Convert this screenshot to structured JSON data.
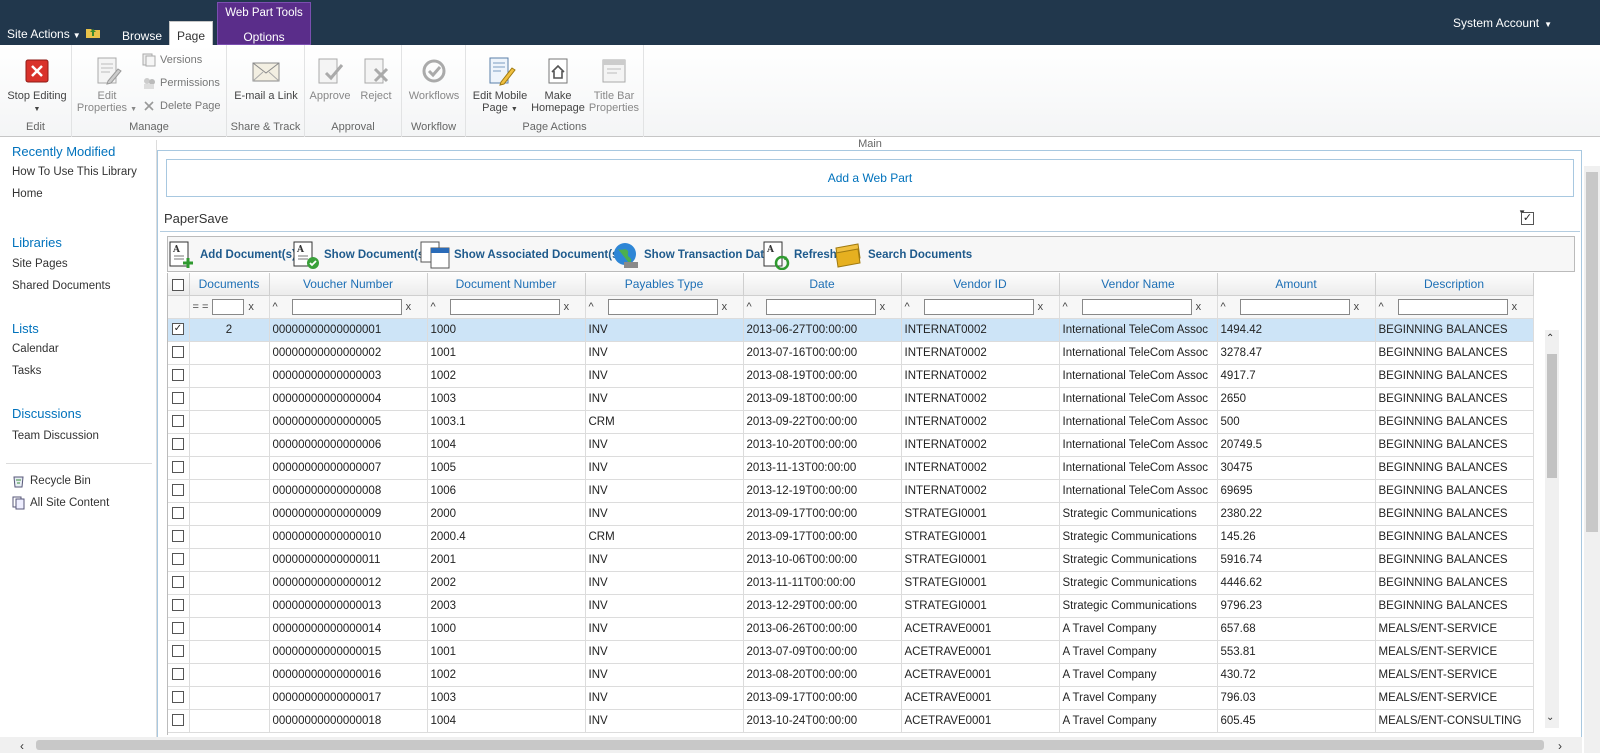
{
  "topbar": {
    "site_actions": "Site Actions",
    "tabs": [
      "Browse",
      "Page"
    ],
    "context_group": "Web Part Tools",
    "context_tab": "Options",
    "account": "System Account"
  },
  "ribbon": {
    "main_label": "Main",
    "groups": [
      {
        "label": "Edit",
        "buttons": [
          "Stop Editing"
        ]
      },
      {
        "label": "Manage",
        "buttons": [
          "Edit Properties",
          "Versions",
          "Permissions",
          "Delete Page"
        ]
      },
      {
        "label": "Share & Track",
        "buttons": [
          "E-mail a Link"
        ]
      },
      {
        "label": "Approval",
        "buttons": [
          "Approve",
          "Reject"
        ]
      },
      {
        "label": "Workflow",
        "buttons": [
          "Workflows"
        ]
      },
      {
        "label": "Page Actions",
        "buttons": [
          "Edit Mobile Page",
          "Make Homepage",
          "Title Bar Properties"
        ]
      }
    ]
  },
  "leftnav": {
    "recently_modified": "Recently Modified",
    "recent_items": [
      "How To Use This Library",
      "Home"
    ],
    "libraries": "Libraries",
    "library_items": [
      "Site Pages",
      "Shared Documents"
    ],
    "lists": "Lists",
    "list_items": [
      "Calendar",
      "Tasks"
    ],
    "discussions": "Discussions",
    "discussion_items": [
      "Team Discussion"
    ],
    "recycle_bin": "Recycle Bin",
    "all_site_content": "All Site Content"
  },
  "zone": {
    "add_webpart": "Add a Web Part"
  },
  "webpart": {
    "title": "PaperSave",
    "toolbar": [
      "Add Document(s)",
      "Show Document(s)",
      "Show Associated Document(s)",
      "Show Transaction Data",
      "Refresh",
      "Search Documents"
    ]
  },
  "grid": {
    "columns": [
      "Documents",
      "Voucher Number",
      "Document Number",
      "Payables Type",
      "Date",
      "Vendor ID",
      "Vendor Name",
      "Amount",
      "Description"
    ],
    "filter_ops": {
      "documents": "= =",
      "others": "^",
      "clear": "x"
    },
    "rows": [
      {
        "checked": true,
        "documents": "2",
        "voucher": "00000000000000001",
        "docnum": "1000",
        "type": "INV",
        "date": "2013-06-27T00:00:00",
        "vendor_id": "INTERNAT0002",
        "vendor_name": "International TeleCom Assoc",
        "amount": "1494.42",
        "description": "BEGINNING BALANCES"
      },
      {
        "checked": false,
        "documents": "",
        "voucher": "00000000000000002",
        "docnum": "1001",
        "type": "INV",
        "date": "2013-07-16T00:00:00",
        "vendor_id": "INTERNAT0002",
        "vendor_name": "International TeleCom Assoc",
        "amount": "3278.47",
        "description": "BEGINNING BALANCES"
      },
      {
        "checked": false,
        "documents": "",
        "voucher": "00000000000000003",
        "docnum": "1002",
        "type": "INV",
        "date": "2013-08-19T00:00:00",
        "vendor_id": "INTERNAT0002",
        "vendor_name": "International TeleCom Assoc",
        "amount": "4917.7",
        "description": "BEGINNING BALANCES"
      },
      {
        "checked": false,
        "documents": "",
        "voucher": "00000000000000004",
        "docnum": "1003",
        "type": "INV",
        "date": "2013-09-18T00:00:00",
        "vendor_id": "INTERNAT0002",
        "vendor_name": "International TeleCom Assoc",
        "amount": "2650",
        "description": "BEGINNING BALANCES"
      },
      {
        "checked": false,
        "documents": "",
        "voucher": "00000000000000005",
        "docnum": "1003.1",
        "type": "CRM",
        "date": "2013-09-22T00:00:00",
        "vendor_id": "INTERNAT0002",
        "vendor_name": "International TeleCom Assoc",
        "amount": "500",
        "description": "BEGINNING BALANCES"
      },
      {
        "checked": false,
        "documents": "",
        "voucher": "00000000000000006",
        "docnum": "1004",
        "type": "INV",
        "date": "2013-10-20T00:00:00",
        "vendor_id": "INTERNAT0002",
        "vendor_name": "International TeleCom Assoc",
        "amount": "20749.5",
        "description": "BEGINNING BALANCES"
      },
      {
        "checked": false,
        "documents": "",
        "voucher": "00000000000000007",
        "docnum": "1005",
        "type": "INV",
        "date": "2013-11-13T00:00:00",
        "vendor_id": "INTERNAT0002",
        "vendor_name": "International TeleCom Assoc",
        "amount": "30475",
        "description": "BEGINNING BALANCES"
      },
      {
        "checked": false,
        "documents": "",
        "voucher": "00000000000000008",
        "docnum": "1006",
        "type": "INV",
        "date": "2013-12-19T00:00:00",
        "vendor_id": "INTERNAT0002",
        "vendor_name": "International TeleCom Assoc",
        "amount": "69695",
        "description": "BEGINNING BALANCES"
      },
      {
        "checked": false,
        "documents": "",
        "voucher": "00000000000000009",
        "docnum": "2000",
        "type": "INV",
        "date": "2013-09-17T00:00:00",
        "vendor_id": "STRATEGI0001",
        "vendor_name": "Strategic Communications",
        "amount": "2380.22",
        "description": "BEGINNING BALANCES"
      },
      {
        "checked": false,
        "documents": "",
        "voucher": "00000000000000010",
        "docnum": "2000.4",
        "type": "CRM",
        "date": "2013-09-17T00:00:00",
        "vendor_id": "STRATEGI0001",
        "vendor_name": "Strategic Communications",
        "amount": "145.26",
        "description": "BEGINNING BALANCES"
      },
      {
        "checked": false,
        "documents": "",
        "voucher": "00000000000000011",
        "docnum": "2001",
        "type": "INV",
        "date": "2013-10-06T00:00:00",
        "vendor_id": "STRATEGI0001",
        "vendor_name": "Strategic Communications",
        "amount": "5916.74",
        "description": "BEGINNING BALANCES"
      },
      {
        "checked": false,
        "documents": "",
        "voucher": "00000000000000012",
        "docnum": "2002",
        "type": "INV",
        "date": "2013-11-11T00:00:00",
        "vendor_id": "STRATEGI0001",
        "vendor_name": "Strategic Communications",
        "amount": "4446.62",
        "description": "BEGINNING BALANCES"
      },
      {
        "checked": false,
        "documents": "",
        "voucher": "00000000000000013",
        "docnum": "2003",
        "type": "INV",
        "date": "2013-12-29T00:00:00",
        "vendor_id": "STRATEGI0001",
        "vendor_name": "Strategic Communications",
        "amount": "9796.23",
        "description": "BEGINNING BALANCES"
      },
      {
        "checked": false,
        "documents": "",
        "voucher": "00000000000000014",
        "docnum": "1000",
        "type": "INV",
        "date": "2013-06-26T00:00:00",
        "vendor_id": "ACETRAVE0001",
        "vendor_name": "A Travel Company",
        "amount": "657.68",
        "description": "MEALS/ENT-SERVICE"
      },
      {
        "checked": false,
        "documents": "",
        "voucher": "00000000000000015",
        "docnum": "1001",
        "type": "INV",
        "date": "2013-07-09T00:00:00",
        "vendor_id": "ACETRAVE0001",
        "vendor_name": "A Travel Company",
        "amount": "553.81",
        "description": "MEALS/ENT-SERVICE"
      },
      {
        "checked": false,
        "documents": "",
        "voucher": "00000000000000016",
        "docnum": "1002",
        "type": "INV",
        "date": "2013-08-20T00:00:00",
        "vendor_id": "ACETRAVE0001",
        "vendor_name": "A Travel Company",
        "amount": "430.72",
        "description": "MEALS/ENT-SERVICE"
      },
      {
        "checked": false,
        "documents": "",
        "voucher": "00000000000000017",
        "docnum": "1003",
        "type": "INV",
        "date": "2013-09-17T00:00:00",
        "vendor_id": "ACETRAVE0001",
        "vendor_name": "A Travel Company",
        "amount": "796.03",
        "description": "MEALS/ENT-SERVICE"
      },
      {
        "checked": false,
        "documents": "",
        "voucher": "00000000000000018",
        "docnum": "1004",
        "type": "INV",
        "date": "2013-10-24T00:00:00",
        "vendor_id": "ACETRAVE0001",
        "vendor_name": "A Travel Company",
        "amount": "605.45",
        "description": "MEALS/ENT-CONSULTING"
      }
    ]
  }
}
